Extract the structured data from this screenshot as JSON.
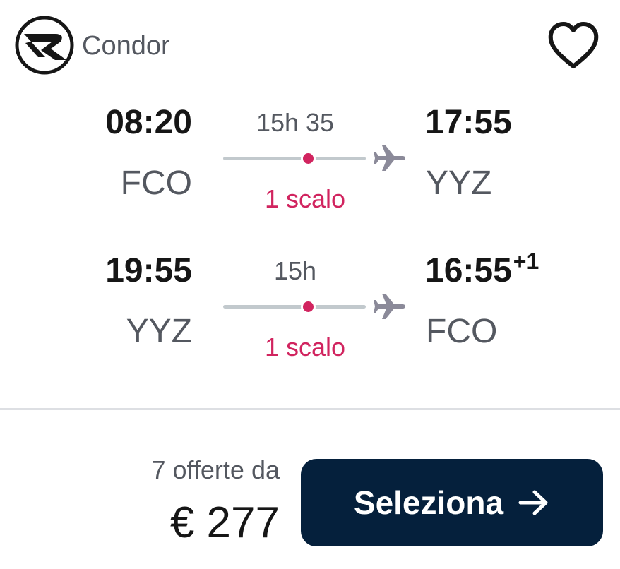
{
  "airline": {
    "name": "Condor",
    "logo_icon": "condor-logo-icon"
  },
  "favorite": {
    "icon": "heart-outline-icon"
  },
  "legs": [
    {
      "departure_time": "08:20",
      "departure_airport": "FCO",
      "duration": "15h 35",
      "stops": "1 scalo",
      "arrival_time": "17:55",
      "arrival_day_offset": "",
      "arrival_airport": "YYZ"
    },
    {
      "departure_time": "19:55",
      "departure_airport": "YYZ",
      "duration": "15h",
      "stops": "1 scalo",
      "arrival_time": "16:55",
      "arrival_day_offset": "+1",
      "arrival_airport": "FCO"
    }
  ],
  "pricing": {
    "offers_label": "7 offerte da",
    "price": "€ 277"
  },
  "select_button": {
    "label": "Seleziona",
    "icon": "arrow-right-icon"
  },
  "colors": {
    "accent_stop": "#d1245f",
    "button_bg": "#05203c",
    "route_line": "#c2c9cd",
    "plane": "#8b8a99"
  }
}
